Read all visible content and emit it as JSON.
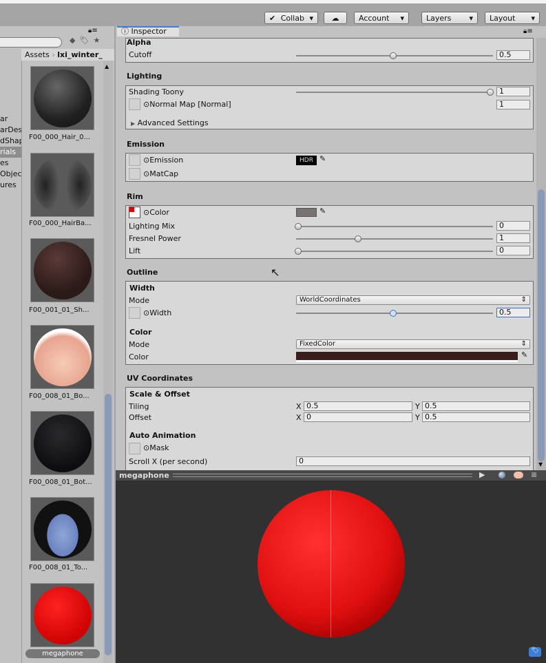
{
  "toolbar": {
    "collab": "Collab",
    "account": "Account",
    "layers": "Layers",
    "layout": "Layout"
  },
  "project": {
    "breadcrumb": [
      "Assets",
      "lxi_winter_"
    ],
    "tree": [
      "ar",
      "arDes",
      "dShap",
      "rials",
      "es",
      "Objec",
      "ures"
    ],
    "selected_tree_index": 3,
    "assets": [
      "F00_000_Hair_0...",
      "F00_000_HairBa...",
      "F00_001_01_Sh...",
      "F00_008_01_Bo...",
      "F00_008_01_Bot...",
      "F00_008_01_To...",
      "megaphone"
    ]
  },
  "inspector": {
    "tab": "Inspector",
    "alpha": {
      "title": "Alpha",
      "cutoff_label": "Cutoff",
      "cutoff": "0.5",
      "cutoff_fraction": 0.5
    },
    "lighting": {
      "title": "Lighting",
      "shading_toony_label": "Shading Toony",
      "shading_toony": "1",
      "normal_map_label": "Normal Map [Normal]",
      "normal_map": "1",
      "advanced": "Advanced Settings"
    },
    "emission": {
      "title": "Emission",
      "emission_label": "Emission",
      "hdr": "HDR",
      "matcap_label": "MatCap"
    },
    "rim": {
      "title": "Rim",
      "color_label": "Color",
      "lighting_mix_label": "Lighting Mix",
      "lighting_mix": "0",
      "fresnel_label": "Fresnel Power",
      "fresnel": "1",
      "fresnel_fraction": 0.3,
      "lift_label": "Lift",
      "lift": "0"
    },
    "outline": {
      "title": "Outline",
      "width_sub": "Width",
      "mode_label": "Mode",
      "width_mode": "WorldCoordinates",
      "width_label": "Width",
      "width": "0.5",
      "width_fraction": 0.5,
      "color_sub": "Color",
      "color_mode_label": "Mode",
      "color_mode": "FixedColor",
      "color_label": "Color",
      "color": "#3a1c1c"
    },
    "uv": {
      "title": "UV Coordinates",
      "scale_sub": "Scale & Offset",
      "tiling_label": "Tiling",
      "tiling_x": "0.5",
      "tiling_y": "0.5",
      "offset_label": "Offset",
      "offset_x": "0",
      "offset_y": "0.5",
      "x": "X",
      "y": "Y",
      "anim_sub": "Auto Animation",
      "mask_label": "Mask",
      "scroll_label": "Scroll X (per second)",
      "scroll": "0"
    }
  },
  "preview": {
    "title": "megaphone"
  }
}
